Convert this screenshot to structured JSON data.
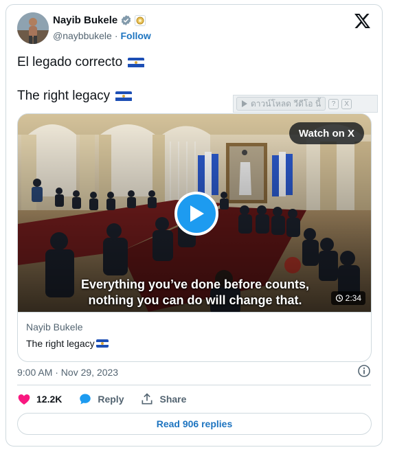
{
  "author": {
    "name": "Nayib Bukele",
    "handle": "@naybbukele",
    "handle_sep": "·",
    "follow_label": "Follow",
    "verified_icon": "verified-badge-icon",
    "affiliation_icon": "affiliation-badge-icon"
  },
  "tweet": {
    "line1": "El legado correcto",
    "line2": "The right legacy",
    "emoji_flag": "flag-el-salvador-icon"
  },
  "download_bar": {
    "label": "ดาวน์โหลด วีดีโอ นี้",
    "help_label": "?",
    "close_label": "X"
  },
  "media": {
    "watch_label": "Watch on X",
    "subtitle_line1": "Everything you’ve done before counts,",
    "subtitle_line2": "nothing you can do will change that.",
    "duration": "2:34"
  },
  "link_card": {
    "author": "Nayib Bukele",
    "title": "The right legacy"
  },
  "meta": {
    "timestamp": "9:00 AM · Nov 29, 2023"
  },
  "actions": {
    "like_count": "12.2K",
    "reply_label": "Reply",
    "share_label": "Share"
  },
  "replies_button": "Read 906 replies",
  "colors": {
    "like": "#f91880",
    "link": "#1d74c0",
    "play": "#1d9bf0",
    "text_secondary": "#536471"
  }
}
